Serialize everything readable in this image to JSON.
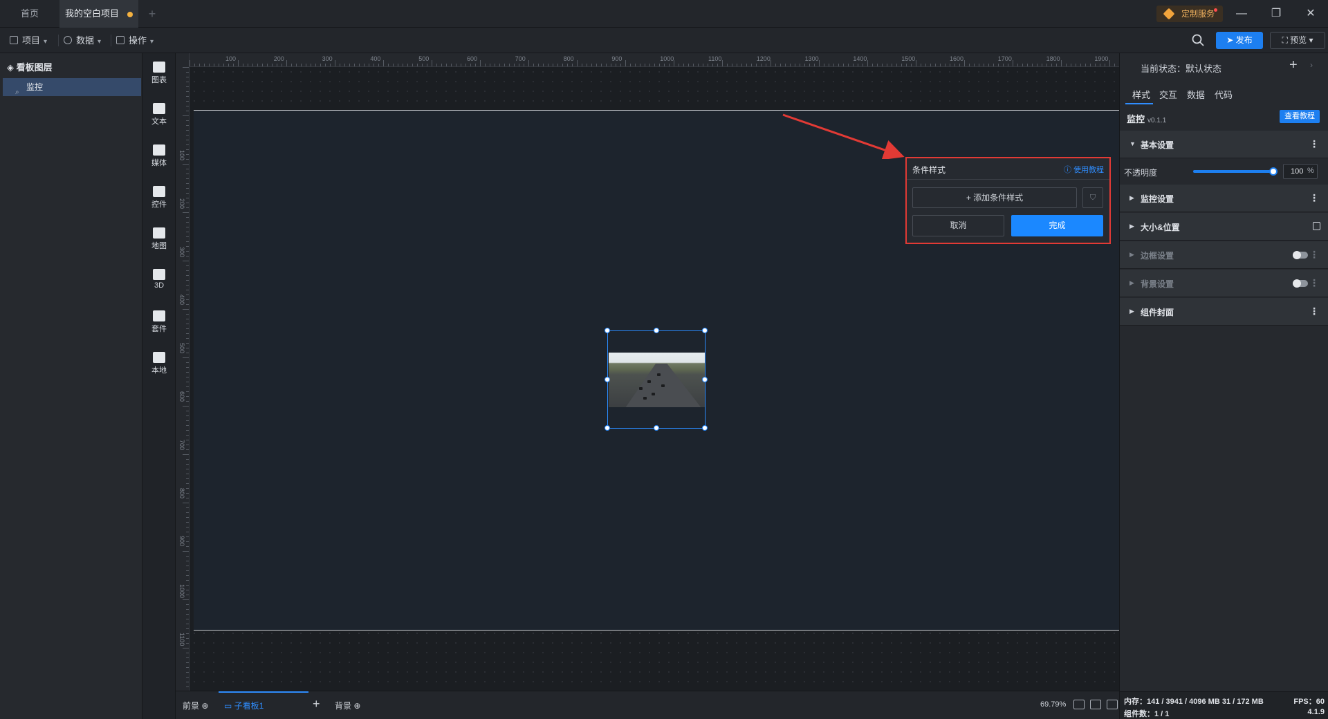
{
  "tabs": {
    "home": "首页",
    "active": "我的空白项目",
    "add": "+"
  },
  "titlebar": {
    "service": "定制服务",
    "minimize": "—",
    "maximize": "❐",
    "close": "✕"
  },
  "menubar": {
    "project": "项目",
    "data": "数据",
    "operations": "操作",
    "publish": "发布",
    "preview": "预览"
  },
  "layers": {
    "title": "看板图层",
    "items": [
      {
        "label": "监控"
      }
    ]
  },
  "library": [
    {
      "label": "图表",
      "icon": "bar-chart-icon"
    },
    {
      "label": "文本",
      "icon": "text-icon"
    },
    {
      "label": "媒体",
      "icon": "media-icon"
    },
    {
      "label": "控件",
      "icon": "control-icon"
    },
    {
      "label": "地图",
      "icon": "map-icon"
    },
    {
      "label": "3D",
      "icon": "cube-icon"
    },
    {
      "label": "套件",
      "icon": "kit-icon"
    },
    {
      "label": "本地",
      "icon": "puzzle-icon"
    }
  ],
  "ruler": {
    "h_labels": [
      "100",
      "200",
      "300",
      "400",
      "500",
      "600",
      "700",
      "800",
      "900",
      "1000",
      "1100",
      "1200",
      "1300",
      "1400",
      "1500",
      "1600",
      "1700",
      "1800",
      "1900"
    ],
    "v_labels": [
      "100",
      "200",
      "300",
      "400",
      "500",
      "600",
      "700",
      "800",
      "900",
      "1000",
      "1100"
    ]
  },
  "popup": {
    "title": "条件样式",
    "help": "使用教程",
    "add": "添加条件样式",
    "cancel": "取消",
    "done": "完成"
  },
  "bottombar": {
    "foreground": "前景",
    "subboard": "子看板1",
    "background": "背景",
    "zoom": "69.79%"
  },
  "props": {
    "state_label": "当前状态：默认状态",
    "tabs": [
      "样式",
      "交互",
      "数据",
      "代码"
    ],
    "component_name": "监控",
    "component_version": "v0.1.1",
    "tutorial": "查看教程",
    "sections": {
      "basic": "基本设置",
      "monitor": "监控设置",
      "size": "大小&位置",
      "border": "边框设置",
      "bg": "背景设置",
      "cover": "组件封面"
    },
    "opacity_label": "不透明度",
    "opacity_value": "100",
    "opacity_unit": "%",
    "opacity_fraction": 1.0
  },
  "perf": {
    "memory": "内存：141 / 3941 / 4096 MB  31 / 172 MB",
    "fps": "FPS：60",
    "count": "组件数：1 / 1",
    "version": "4.1.9"
  },
  "colors": {
    "accent": "#1d7ff0",
    "highlight_border": "#e23a35",
    "warning_dot": "#f5b240"
  }
}
